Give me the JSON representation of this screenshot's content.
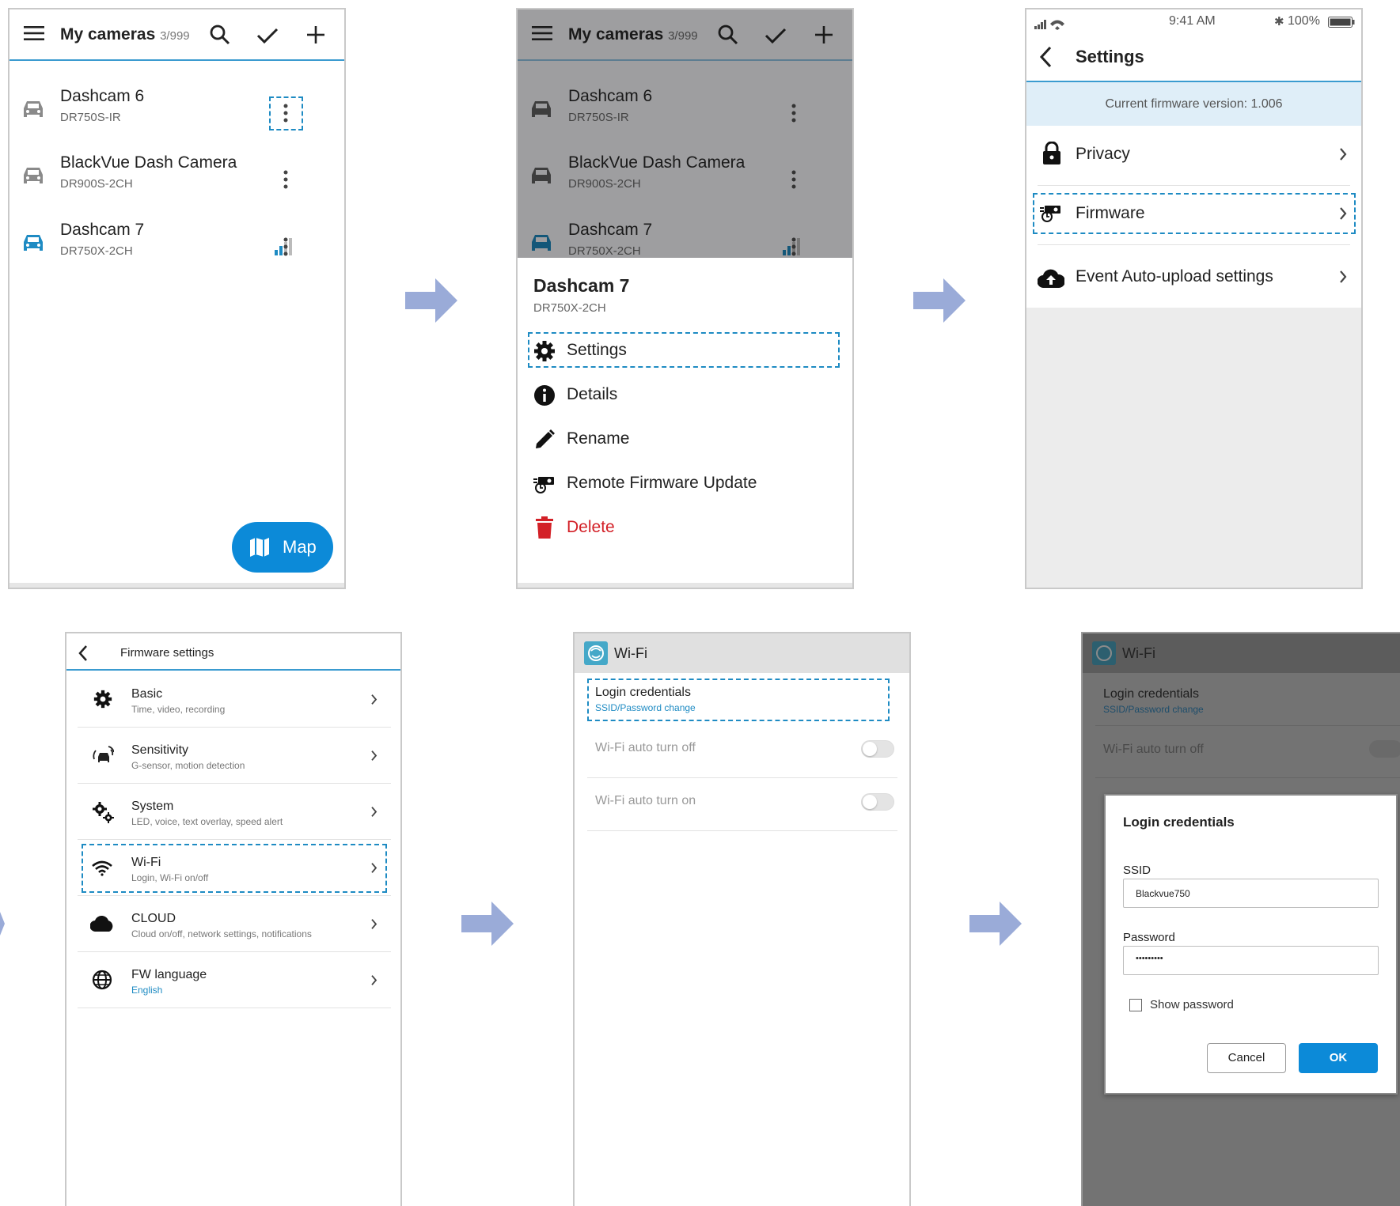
{
  "colors": {
    "accent": "#1e8bc3",
    "arrow": "#9aabd8",
    "delete_red": "#d32027",
    "ok_blue": "#0c8ad8"
  },
  "s1": {
    "title": "My cameras",
    "count": "3/999",
    "cams": [
      {
        "name": "Dashcam 6",
        "model": "DR750S-IR"
      },
      {
        "name": "BlackVue Dash Camera",
        "model": "DR900S-2CH"
      },
      {
        "name": "Dashcam 7",
        "model": "DR750X-2CH"
      }
    ],
    "map_label": "Map"
  },
  "s2": {
    "title": "My cameras",
    "count": "3/999",
    "cams": [
      {
        "name": "Dashcam 6",
        "model": "DR750S-IR"
      },
      {
        "name": "BlackVue Dash Camera",
        "model": "DR900S-2CH"
      },
      {
        "name": "Dashcam 7",
        "model": "DR750X-2CH"
      }
    ],
    "sheet_title": "Dashcam 7",
    "sheet_model": "DR750X-2CH",
    "menu": [
      "Settings",
      "Details",
      "Rename",
      "Remote Firmware Update",
      "Delete"
    ]
  },
  "s3": {
    "status_time": "9:41 AM",
    "status_battery": "100%",
    "title": "Settings",
    "firmware_banner": "Current firmware version: 1.006",
    "items": [
      "Privacy",
      "Firmware",
      "Event Auto-upload settings"
    ]
  },
  "s4": {
    "title": "Firmware settings",
    "items": [
      {
        "label": "Basic",
        "sub": "Time, video, recording"
      },
      {
        "label": "Sensitivity",
        "sub": "G-sensor, motion detection"
      },
      {
        "label": "System",
        "sub": "LED, voice, text overlay, speed alert"
      },
      {
        "label": "Wi-Fi",
        "sub": "Login, Wi-Fi on/off"
      },
      {
        "label": "CLOUD",
        "sub": "Cloud on/off, network settings, notifications"
      },
      {
        "label": "FW language",
        "sub": "English"
      }
    ]
  },
  "s5": {
    "title": "Wi-Fi",
    "login_label": "Login credentials",
    "login_sub": "SSID/Password change",
    "auto_off": "Wi-Fi auto turn off",
    "auto_on": "Wi-Fi auto turn on"
  },
  "s6": {
    "title": "Wi-Fi",
    "login_label": "Login credentials",
    "login_sub": "SSID/Password change",
    "auto_off": "Wi-Fi auto turn off",
    "dialog": {
      "title": "Login credentials",
      "ssid_label": "SSID",
      "ssid_value": "Blackvue750",
      "password_label": "Password",
      "password_value": "•••••••••",
      "show_password": "Show password",
      "cancel": "Cancel",
      "ok": "OK"
    }
  }
}
